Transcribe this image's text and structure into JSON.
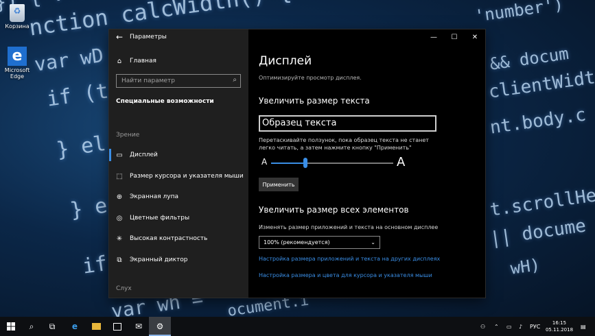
{
  "desktop": {
    "code_lines": [
      "}) { . . . ,",
      "nction calcWidth() {",
      "var wD",
      "if (t",
      "} el",
      "} e",
      "if (",
      "var wh =",
      "'number')",
      "&& docum",
      "clientWidt",
      "nt.body.c",
      "t.scrollHe",
      "|| docume",
      "wH)",
      "ocument.i"
    ],
    "icons": [
      {
        "label": "Корзина",
        "icon": "recycle-bin-icon"
      },
      {
        "label": "Microsoft Edge",
        "icon": "edge-icon"
      }
    ]
  },
  "window": {
    "title": "Параметры",
    "back_glyph": "←",
    "minimize_glyph": "—",
    "maximize_glyph": "☐",
    "close_glyph": "✕"
  },
  "nav": {
    "home_label": "Главная",
    "search_placeholder": "Найти параметр",
    "heading": "Специальные возможности",
    "section_vision": "Зрение",
    "items": [
      {
        "label": "Дисплей",
        "icon": "monitor-icon",
        "glyph": "▭",
        "active": true
      },
      {
        "label": "Размер курсора и указателя мыши",
        "icon": "cursor-icon",
        "glyph": "⬚",
        "active": false
      },
      {
        "label": "Экранная лупа",
        "icon": "magnifier-icon",
        "glyph": "⊕",
        "active": false
      },
      {
        "label": "Цветные фильтры",
        "icon": "color-filter-icon",
        "glyph": "◎",
        "active": false
      },
      {
        "label": "Высокая контрастность",
        "icon": "contrast-icon",
        "glyph": "✳",
        "active": false
      },
      {
        "label": "Экранный диктор",
        "icon": "narrator-icon",
        "glyph": "⧉",
        "active": false
      }
    ],
    "section_hearing": "Слух"
  },
  "main": {
    "title": "Дисплей",
    "subtitle": "Оптимизируйте просмотр дисплея.",
    "text_size": {
      "heading": "Увеличить размер текста",
      "sample": "Образец текста",
      "hint": "Перетаскивайте ползунок, пока образец текста не станет легко читать, а затем нажмите кнопку \"Применить\"",
      "small_a": "A",
      "big_a": "A",
      "slider_fraction": 0.28,
      "apply_label": "Применить"
    },
    "scale": {
      "heading": "Увеличить размер всех элементов",
      "label": "Изменять размер приложений и текста на основном дисплее",
      "selected": "100% (рекомендуется)",
      "link1": "Настройка размера приложений и текста на других дисплеях",
      "link2": "Настройка размера и цвета для курсора и указателя мыши"
    }
  },
  "taskbar": {
    "tray_lang": "РУС",
    "time": "16:15",
    "date": "05.11.2018"
  },
  "colors": {
    "accent": "#3a8ee6",
    "nav_bg": "#1f1f1f",
    "main_bg": "#000000"
  }
}
